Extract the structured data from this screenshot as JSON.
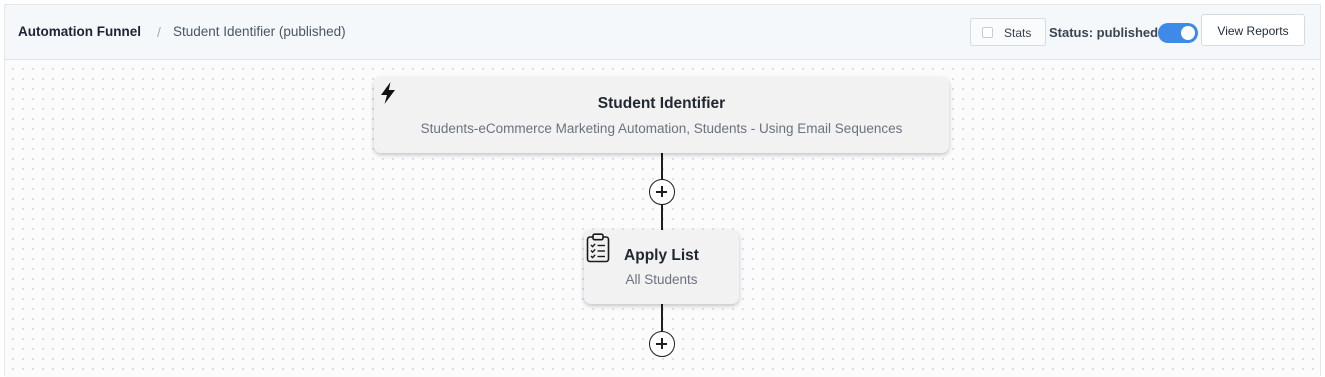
{
  "breadcrumb": {
    "root": "Automation Funnel",
    "separator": "/",
    "current": "Student Identifier (published)"
  },
  "toolbar": {
    "stats_label": "Stats",
    "stats_checked": false,
    "status_label": "Status: published",
    "status_on": true,
    "view_reports_label": "View Reports"
  },
  "colors": {
    "accent": "#3d8ae8",
    "card_bg": "#f2f2f2",
    "connector": "#1e1e1e"
  },
  "nodes": {
    "trigger": {
      "icon": "lightning-bolt-icon",
      "title": "Student Identifier",
      "subtitle": "Students-eCommerce Marketing Automation, Students - Using Email Sequences"
    },
    "action": {
      "icon": "clipboard-checklist-icon",
      "title": "Apply List",
      "subtitle": "All Students"
    }
  }
}
